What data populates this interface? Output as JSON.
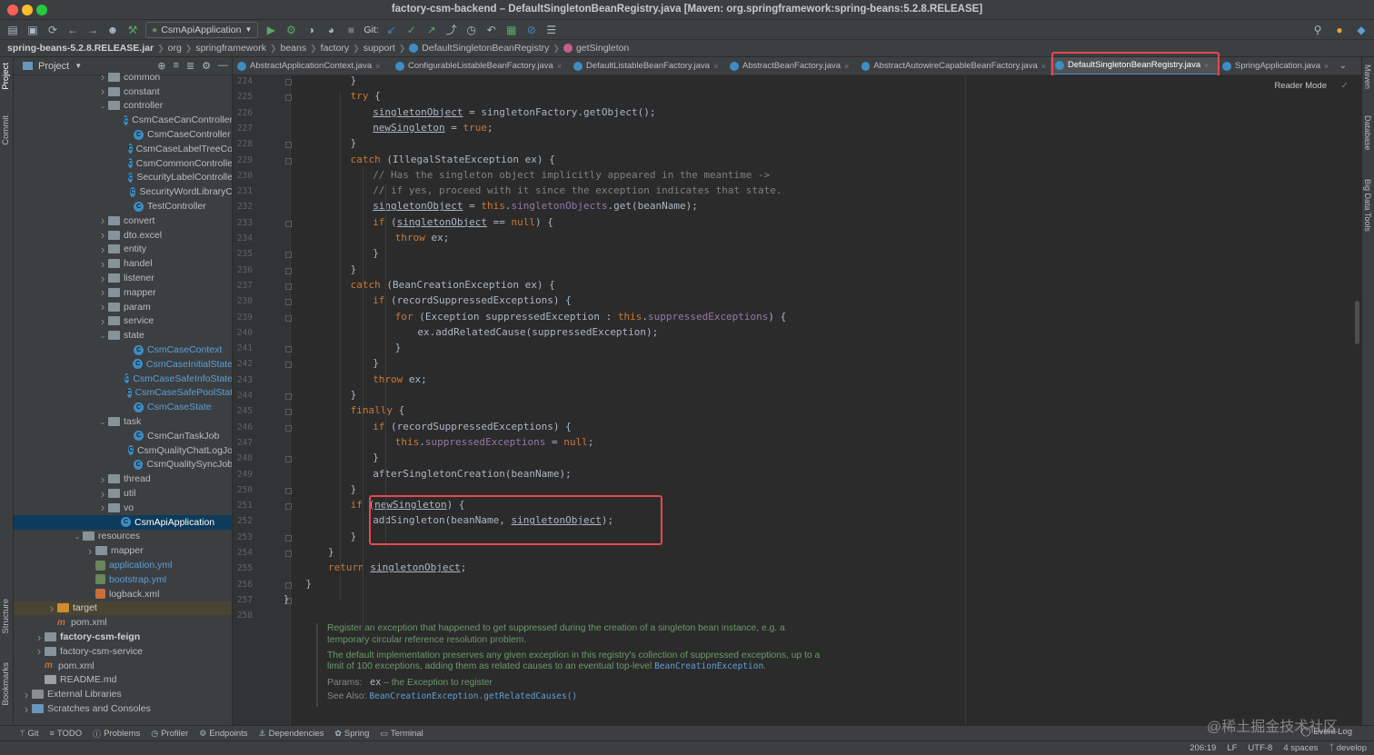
{
  "window": {
    "title": "factory-csm-backend – DefaultSingletonBeanRegistry.java [Maven: org.springframework:spring-beans:5.2.8.RELEASE]"
  },
  "toolbar": {
    "run_config": "CsmApiApplication",
    "git_label": "Git:"
  },
  "breadcrumb": [
    {
      "label": "spring-beans-5.2.8.RELEASE.jar",
      "bold": true
    },
    {
      "label": "org"
    },
    {
      "label": "springframework"
    },
    {
      "label": "beans"
    },
    {
      "label": "factory"
    },
    {
      "label": "support"
    },
    {
      "label": "DefaultSingletonBeanRegistry",
      "icon": "class"
    },
    {
      "label": "getSingleton",
      "icon": "method"
    }
  ],
  "left_tabs": {
    "project": "Project",
    "commit": "Commit",
    "structure": "Structure",
    "bookmarks": "Bookmarks"
  },
  "right_tabs": {
    "maven": "Maven",
    "database": "Database",
    "bigdata": "Big Data Tools"
  },
  "project_panel": {
    "title": "Project",
    "tree": [
      {
        "label": "common",
        "depth": 7,
        "type": "folder",
        "arrow": "right"
      },
      {
        "label": "constant",
        "depth": 7,
        "type": "folder",
        "arrow": "right"
      },
      {
        "label": "controller",
        "depth": 7,
        "type": "folder",
        "arrow": "down"
      },
      {
        "label": "CsmCaseCanController",
        "depth": 9,
        "type": "class"
      },
      {
        "label": "CsmCaseController",
        "depth": 9,
        "type": "class"
      },
      {
        "label": "CsmCaseLabelTreeCo",
        "depth": 9,
        "type": "class"
      },
      {
        "label": "CsmCommonControlle",
        "depth": 9,
        "type": "class"
      },
      {
        "label": "SecurityLabelControlle",
        "depth": 9,
        "type": "class"
      },
      {
        "label": "SecurityWordLibraryC",
        "depth": 9,
        "type": "class"
      },
      {
        "label": "TestController",
        "depth": 9,
        "type": "class"
      },
      {
        "label": "convert",
        "depth": 7,
        "type": "folder",
        "arrow": "right"
      },
      {
        "label": "dto.excel",
        "depth": 7,
        "type": "folder",
        "arrow": "right"
      },
      {
        "label": "entity",
        "depth": 7,
        "type": "folder",
        "arrow": "right"
      },
      {
        "label": "handel",
        "depth": 7,
        "type": "folder",
        "arrow": "right"
      },
      {
        "label": "listener",
        "depth": 7,
        "type": "folder",
        "arrow": "right"
      },
      {
        "label": "mapper",
        "depth": 7,
        "type": "folder",
        "arrow": "right"
      },
      {
        "label": "param",
        "depth": 7,
        "type": "folder",
        "arrow": "right"
      },
      {
        "label": "service",
        "depth": 7,
        "type": "folder",
        "arrow": "right"
      },
      {
        "label": "state",
        "depth": 7,
        "type": "folder",
        "arrow": "down"
      },
      {
        "label": "CsmCaseContext",
        "depth": 9,
        "type": "class",
        "style": "blue"
      },
      {
        "label": "CsmCaseInitialState",
        "depth": 9,
        "type": "class",
        "style": "blue"
      },
      {
        "label": "CsmCaseSafeInfoState",
        "depth": 9,
        "type": "class",
        "style": "blue"
      },
      {
        "label": "CsmCaseSafePoolStat",
        "depth": 9,
        "type": "class",
        "style": "blue"
      },
      {
        "label": "CsmCaseState",
        "depth": 9,
        "type": "class",
        "style": "blue"
      },
      {
        "label": "task",
        "depth": 7,
        "type": "folder",
        "arrow": "down"
      },
      {
        "label": "CsmCanTaskJob",
        "depth": 9,
        "type": "class"
      },
      {
        "label": "CsmQualityChatLogJo",
        "depth": 9,
        "type": "class"
      },
      {
        "label": "CsmQualitySyncJob",
        "depth": 9,
        "type": "class"
      },
      {
        "label": "thread",
        "depth": 7,
        "type": "folder",
        "arrow": "right"
      },
      {
        "label": "util",
        "depth": 7,
        "type": "folder",
        "arrow": "right"
      },
      {
        "label": "vo",
        "depth": 7,
        "type": "folder",
        "arrow": "right"
      },
      {
        "label": "CsmApiApplication",
        "depth": 8,
        "type": "class",
        "selected": true
      },
      {
        "label": "resources",
        "depth": 5,
        "type": "folder",
        "arrow": "down"
      },
      {
        "label": "mapper",
        "depth": 6,
        "type": "folder",
        "arrow": "right"
      },
      {
        "label": "application.yml",
        "depth": 6,
        "type": "yml",
        "style": "blue"
      },
      {
        "label": "bootstrap.yml",
        "depth": 6,
        "type": "yml",
        "style": "blue"
      },
      {
        "label": "logback.xml",
        "depth": 6,
        "type": "xml"
      },
      {
        "label": "target",
        "depth": 3,
        "type": "target",
        "arrow": "right",
        "highlight": true
      },
      {
        "label": "pom.xml",
        "depth": 3,
        "type": "maven"
      },
      {
        "label": "factory-csm-feign",
        "depth": 2,
        "type": "folder",
        "arrow": "right",
        "style": "bold"
      },
      {
        "label": "factory-csm-service",
        "depth": 2,
        "type": "folder",
        "arrow": "right"
      },
      {
        "label": "pom.xml",
        "depth": 2,
        "type": "maven"
      },
      {
        "label": "README.md",
        "depth": 2,
        "type": "file"
      },
      {
        "label": "External Libraries",
        "depth": 1,
        "type": "lib",
        "arrow": "right"
      },
      {
        "label": "Scratches and Consoles",
        "depth": 1,
        "type": "scratch",
        "arrow": "right"
      }
    ]
  },
  "tabs": [
    {
      "label": "AbstractApplicationContext.java"
    },
    {
      "label": "ConfigurableListableBeanFactory.java"
    },
    {
      "label": "DefaultListableBeanFactory.java"
    },
    {
      "label": "AbstractBeanFactory.java"
    },
    {
      "label": "AbstractAutowireCapableBeanFactory.java"
    },
    {
      "label": "DefaultSingletonBeanRegistry.java",
      "active": true
    },
    {
      "label": "SpringApplication.java"
    }
  ],
  "editor": {
    "reader_mode": "Reader Mode",
    "line_numbers": [
      "224",
      "225",
      "226",
      "227",
      "228",
      "229",
      "230",
      "231",
      "232",
      "233",
      "234",
      "235",
      "236",
      "237",
      "238",
      "239",
      "240",
      "241",
      "242",
      "243",
      "244",
      "245",
      "246",
      "247",
      "248",
      "249",
      "250",
      "251",
      "252",
      "253",
      "254",
      "255",
      "256",
      "257",
      "258"
    ],
    "lines": [
      [
        [
          "",
          "}"
        ]
      ],
      [
        [
          "kw",
          "try"
        ],
        [
          "",
          " {"
        ]
      ],
      [
        [
          "und",
          "singletonObject"
        ],
        [
          "",
          " = singletonFactory.getObject();"
        ]
      ],
      [
        [
          "und",
          "newSingleton"
        ],
        [
          "",
          " = "
        ],
        [
          "kw",
          "true"
        ],
        [
          "",
          ";"
        ]
      ],
      [
        [
          "",
          "}"
        ]
      ],
      [
        [
          "kw",
          "catch"
        ],
        [
          "",
          " (IllegalStateException ex) {"
        ]
      ],
      [
        [
          "cmt",
          "// Has the singleton object implicitly appeared in the meantime ->"
        ]
      ],
      [
        [
          "cmt",
          "// if yes, proceed with it since the exception indicates that state."
        ]
      ],
      [
        [
          "und",
          "singletonObject"
        ],
        [
          "",
          " = "
        ],
        [
          "kw",
          "this"
        ],
        [
          "",
          "."
        ],
        [
          "fld",
          "singletonObjects"
        ],
        [
          "",
          ".get(beanName);"
        ]
      ],
      [
        [
          "kw",
          "if"
        ],
        [
          "",
          " ("
        ],
        [
          "und",
          "singletonObject"
        ],
        [
          "",
          " == "
        ],
        [
          "kw",
          "null"
        ],
        [
          "",
          ") {"
        ]
      ],
      [
        [
          "kw",
          "throw"
        ],
        [
          "",
          " ex;"
        ]
      ],
      [
        [
          "",
          "}"
        ]
      ],
      [
        [
          "",
          "}"
        ]
      ],
      [
        [
          "kw",
          "catch"
        ],
        [
          "",
          " (BeanCreationException ex) {"
        ]
      ],
      [
        [
          "kw",
          "if"
        ],
        [
          "",
          " (recordSuppressedExceptions) {"
        ]
      ],
      [
        [
          "kw",
          "for"
        ],
        [
          "",
          " (Exception suppressedException : "
        ],
        [
          "kw",
          "this"
        ],
        [
          "",
          "."
        ],
        [
          "fld",
          "suppressedExceptions"
        ],
        [
          "",
          ") {"
        ]
      ],
      [
        [
          "",
          "ex.addRelatedCause(suppressedException);"
        ]
      ],
      [
        [
          "",
          "}"
        ]
      ],
      [
        [
          "",
          "}"
        ]
      ],
      [
        [
          "kw",
          "throw"
        ],
        [
          "",
          " ex;"
        ]
      ],
      [
        [
          "",
          "}"
        ]
      ],
      [
        [
          "kw",
          "finally"
        ],
        [
          "",
          " {"
        ]
      ],
      [
        [
          "kw",
          "if"
        ],
        [
          "",
          " (recordSuppressedExceptions) {"
        ]
      ],
      [
        [
          "kw",
          "this"
        ],
        [
          "",
          "."
        ],
        [
          "fld",
          "suppressedExceptions"
        ],
        [
          "",
          " = "
        ],
        [
          "kw",
          "null"
        ],
        [
          "",
          ";"
        ]
      ],
      [
        [
          "",
          "}"
        ]
      ],
      [
        [
          "",
          "afterSingletonCreation(beanName);"
        ]
      ],
      [
        [
          "",
          "}"
        ]
      ],
      [
        [
          "kw",
          "if"
        ],
        [
          "",
          " ("
        ],
        [
          "und",
          "newSingleton"
        ],
        [
          "",
          ") {"
        ]
      ],
      [
        [
          "",
          "addSingleton(beanName, "
        ],
        [
          "und",
          "singletonObject"
        ],
        [
          "",
          ");"
        ]
      ],
      [
        [
          "",
          "}"
        ]
      ],
      [
        [
          "",
          "}"
        ]
      ],
      [
        [
          "kw",
          "return"
        ],
        [
          "",
          " "
        ],
        [
          "und",
          "singletonObject"
        ],
        [
          "",
          ";"
        ]
      ],
      [
        [
          "",
          "}"
        ]
      ],
      [
        [
          "",
          "}"
        ]
      ],
      [
        [
          "",
          ""
        ]
      ]
    ],
    "doc": {
      "p1": "Register an exception that happened to get suppressed during the creation of a singleton bean instance, e.g. a temporary circular reference resolution problem.",
      "p2_text": "The default implementation preserves any given exception in this registry's collection of suppressed exceptions, up to a limit of 100 exceptions, adding them as related causes to an eventual top-level",
      "p2_code": "BeanCreationException",
      "params_label": "Params:",
      "params_name": "ex",
      "params_desc": "– the Exception to register",
      "see_label": "See Also:",
      "see_code": "BeanCreationException.getRelatedCauses()"
    }
  },
  "bottom_tools": [
    {
      "icon": "git-icon",
      "label": "Git"
    },
    {
      "icon": "todo-icon",
      "label": "TODO"
    },
    {
      "icon": "problems-icon",
      "label": "Problems"
    },
    {
      "icon": "profiler-icon",
      "label": "Profiler"
    },
    {
      "icon": "endpoints-icon",
      "label": "Endpoints"
    },
    {
      "icon": "dependencies-icon",
      "label": "Dependencies"
    },
    {
      "icon": "spring-icon",
      "label": "Spring"
    },
    {
      "icon": "terminal-icon",
      "label": "Terminal"
    }
  ],
  "event_log": "Event Log",
  "watermark": "@稀土掘金技术社区",
  "status": {
    "position": "206:19",
    "line_sep": "LF",
    "encoding": "UTF-8",
    "indent": "4 spaces",
    "branch": "develop"
  }
}
